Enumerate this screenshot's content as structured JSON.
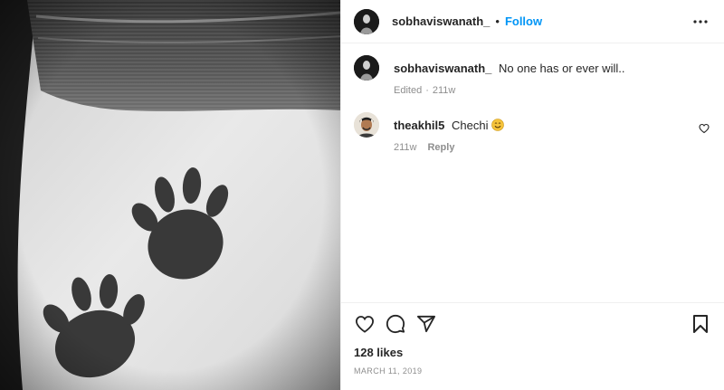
{
  "post": {
    "author": "sobhaviswanath_",
    "separator": "•",
    "follow_label": "Follow",
    "more_icon": "more-horizontal-icon"
  },
  "comments": [
    {
      "username": "sobhaviswanath_",
      "text": "No one has or ever will..",
      "meta_edited": "Edited",
      "meta_age": "211w"
    },
    {
      "username": "theakhil5",
      "text": "Chechi",
      "emoji": "smiling-face-emoji",
      "meta_age": "211w",
      "reply_label": "Reply"
    }
  ],
  "actions": {
    "like_icon": "heart-icon",
    "comment_icon": "comment-icon",
    "share_icon": "share-icon",
    "save_icon": "bookmark-icon"
  },
  "likes_text": "128 likes",
  "date_text": "MARCH 11, 2019",
  "colors": {
    "link": "#0095f6",
    "muted": "#8e8e8e",
    "text": "#262626"
  }
}
